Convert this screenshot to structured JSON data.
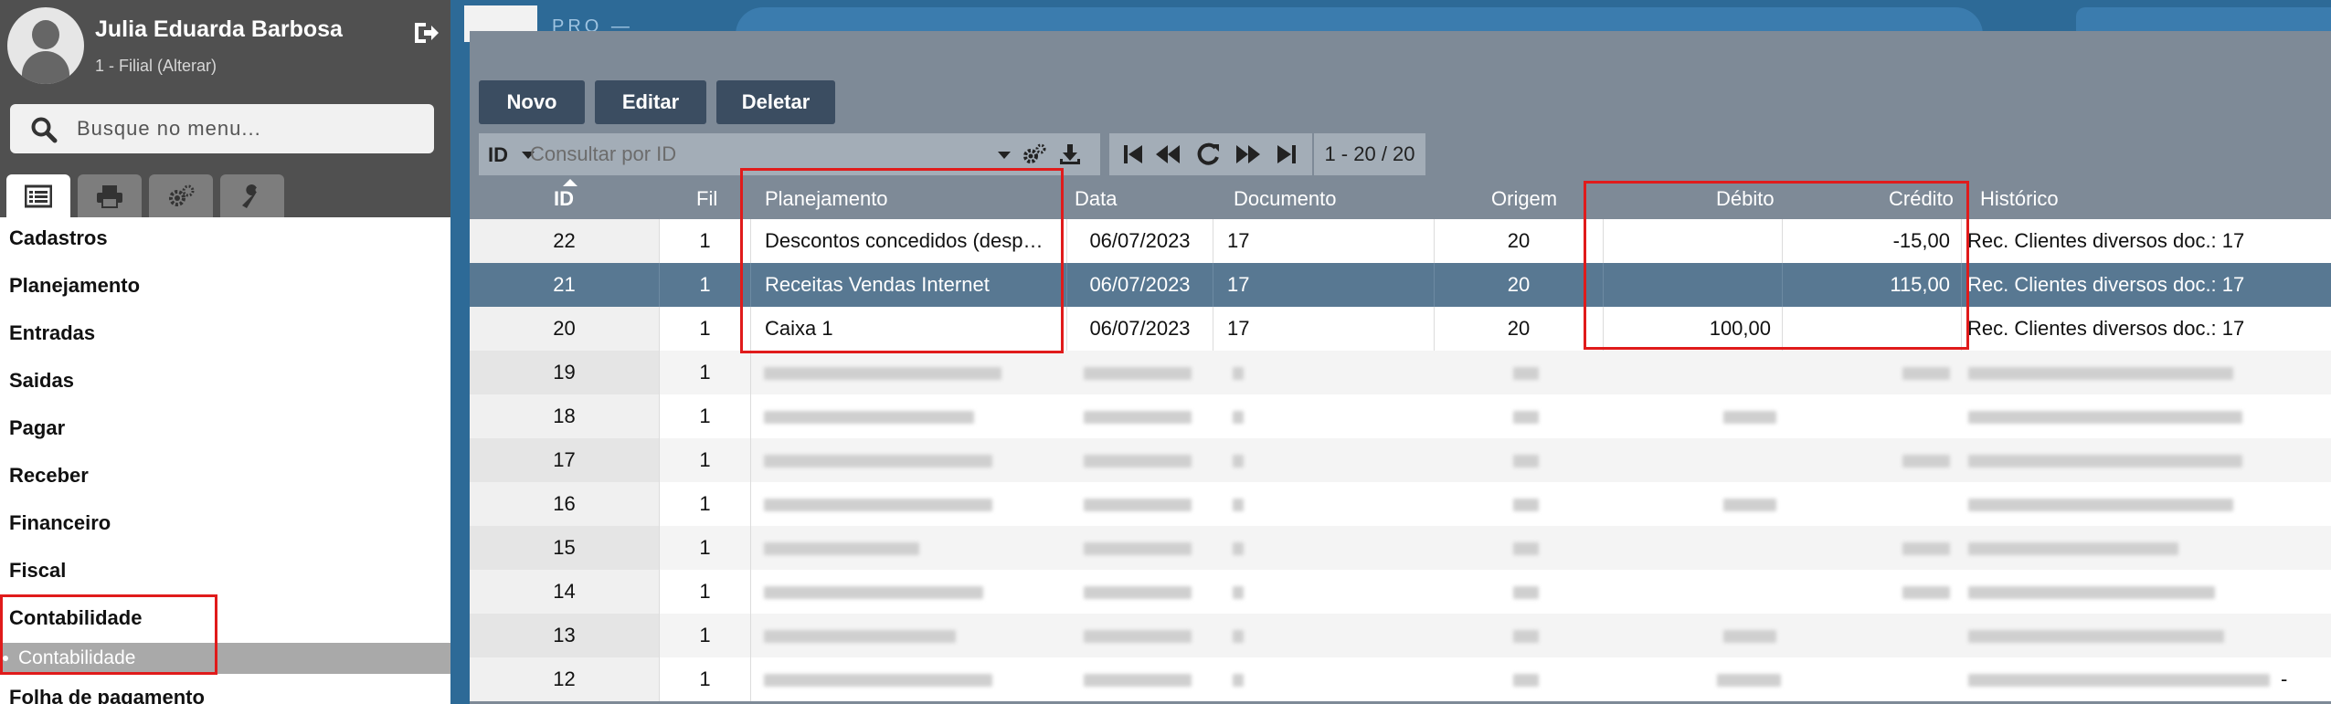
{
  "user": {
    "name": "Julia Eduarda Barbosa",
    "filial": "1 - Filial (Alterar)"
  },
  "sidebar": {
    "search_placeholder": "Busque no menu...",
    "tabs": [
      "list-icon",
      "print-icon",
      "gears-icon",
      "wrench-icon"
    ],
    "menu": [
      {
        "label": "Cadastros"
      },
      {
        "label": "Planejamento"
      },
      {
        "label": "Entradas"
      },
      {
        "label": "Saidas"
      },
      {
        "label": "Pagar"
      },
      {
        "label": "Receber"
      },
      {
        "label": "Financeiro"
      },
      {
        "label": "Fiscal"
      },
      {
        "label": "Contabilidade"
      },
      {
        "label": "Folha de pagamento"
      }
    ],
    "submenu_active": "Contabilidade"
  },
  "app": {
    "brand": "PRO —"
  },
  "toolbar": {
    "novo": "Novo",
    "editar": "Editar",
    "deletar": "Deletar"
  },
  "filter": {
    "field": "ID",
    "placeholder": "Consultar por ID"
  },
  "pager": {
    "count": "1 - 20 / 20"
  },
  "table": {
    "headers": {
      "id": "ID",
      "fil": "Fil",
      "planejamento": "Planejamento",
      "data": "Data",
      "documento": "Documento",
      "origem": "Origem",
      "debito": "Débito",
      "credito": "Crédito",
      "historico": "Histórico"
    },
    "rows": [
      {
        "id": "22",
        "fil": "1",
        "planejamento": "Descontos concedidos (desp…",
        "data": "06/07/2023",
        "documento": "17",
        "origem": "20",
        "debito": "",
        "credito": "-15,00",
        "historico": "Rec. Clientes diversos doc.: 17"
      },
      {
        "id": "21",
        "fil": "1",
        "planejamento": "Receitas Vendas Internet",
        "data": "06/07/2023",
        "documento": "17",
        "origem": "20",
        "debito": "",
        "credito": "115,00",
        "historico": "Rec. Clientes diversos doc.: 17"
      },
      {
        "id": "20",
        "fil": "1",
        "planejamento": "Caixa 1",
        "data": "06/07/2023",
        "documento": "17",
        "origem": "20",
        "debito": "100,00",
        "credito": "",
        "historico": "Rec. Clientes diversos doc.: 17"
      },
      {
        "id": "19",
        "fil": "1"
      },
      {
        "id": "18",
        "fil": "1"
      },
      {
        "id": "17",
        "fil": "1"
      },
      {
        "id": "16",
        "fil": "1"
      },
      {
        "id": "15",
        "fil": "1"
      },
      {
        "id": "14",
        "fil": "1"
      },
      {
        "id": "13",
        "fil": "1"
      },
      {
        "id": "12",
        "fil": "1",
        "trailing": "-"
      }
    ]
  },
  "colors": {
    "sidebar_top": "#505050",
    "panel_bg": "#7e8a97",
    "button_bg": "#3b4d61",
    "selected_row": "#587892",
    "highlight": "#e01b1b"
  }
}
